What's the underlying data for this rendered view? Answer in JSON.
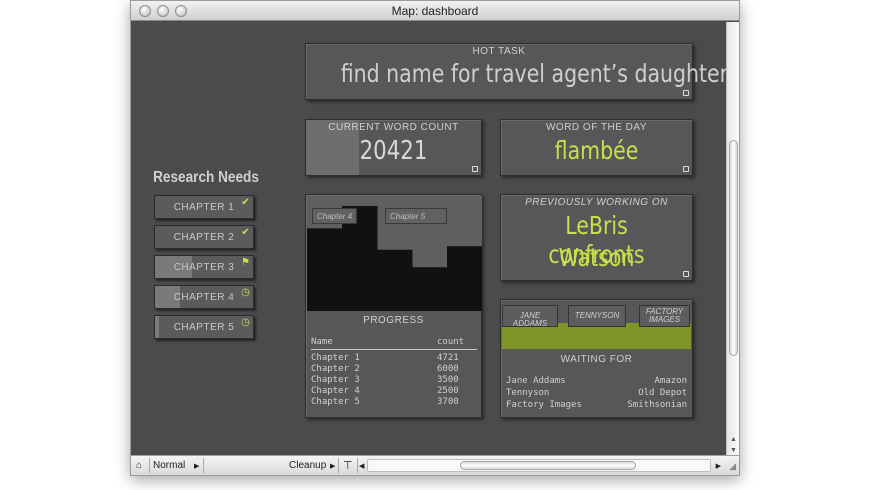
{
  "window": {
    "title": "Map: dashboard"
  },
  "hot_task": {
    "label": "HOT TASK",
    "value": "find name for travel agent’s daughter"
  },
  "word_count": {
    "label": "CURRENT WORD COUNT",
    "value": "20421",
    "progress": 0.3
  },
  "word_of_day": {
    "label": "WORD OF THE DAY",
    "value": "flambée"
  },
  "previously_working": {
    "label": "PREVIOUSLY WORKING ON",
    "line1": "LeBris confronts",
    "line2": "Watson"
  },
  "research": {
    "title": "Research Needs",
    "chapters": [
      {
        "label": "CHAPTER 1",
        "icon": "check-icon",
        "progress": 0.0
      },
      {
        "label": "CHAPTER 2",
        "icon": "check-icon",
        "progress": 0.0
      },
      {
        "label": "CHAPTER 3",
        "icon": "flag-icon",
        "progress": 0.38
      },
      {
        "label": "CHAPTER 4",
        "icon": "clock-icon",
        "progress": 0.26
      },
      {
        "label": "CHAPTER 5",
        "icon": "clock-icon",
        "progress": 0.04
      }
    ]
  },
  "progress": {
    "label": "PROGRESS",
    "tags": [
      "Chapter 4",
      "Chapter 5"
    ],
    "header": {
      "name": "Name",
      "count": "count"
    },
    "rows": [
      {
        "name": "Chapter 1",
        "count": "4721"
      },
      {
        "name": "Chapter 2",
        "count": "6000"
      },
      {
        "name": "Chapter 3",
        "count": "3500"
      },
      {
        "name": "Chapter 4",
        "count": "2500"
      },
      {
        "name": "Chapter 5",
        "count": "3700"
      }
    ]
  },
  "chart_data": {
    "type": "bar",
    "categories": [
      "Chapter 1",
      "Chapter 2",
      "Chapter 3",
      "Chapter 4",
      "Chapter 5"
    ],
    "values": [
      4721,
      6000,
      3500,
      2500,
      3700
    ],
    "ylim": [
      0,
      6000
    ],
    "grid": false,
    "legend": "none",
    "colors": {
      "bar": "#111111",
      "background": "#5f5f61"
    }
  },
  "waiting_for": {
    "label": "WAITING FOR",
    "tags": [
      "JANE ADDAMS",
      "TENNYSON",
      "FACTORY IMAGES"
    ],
    "rows": [
      {
        "name": "Jane Addams",
        "source": "Amazon"
      },
      {
        "name": "Tennyson",
        "source": "Old Depot"
      },
      {
        "name": "Factory Images",
        "source": "Smithsonian"
      }
    ]
  },
  "statusbar": {
    "mode": "Normal",
    "cleanup": "Cleanup"
  },
  "colors": {
    "accent": "#c9e04a",
    "olive": "#7e9628",
    "panel": "#575759",
    "background": "#4b4b4d"
  }
}
